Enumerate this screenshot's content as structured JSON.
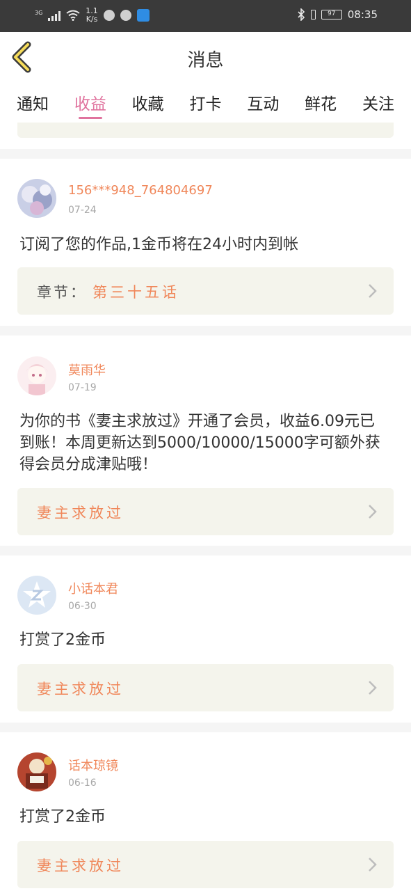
{
  "status_bar": {
    "network": "3G",
    "speed": "1.1",
    "speed_unit": "K/s",
    "battery": "97",
    "time": "08:35"
  },
  "header": {
    "title": "消息"
  },
  "tabs": [
    {
      "label": "通知",
      "active": false
    },
    {
      "label": "收益",
      "active": true
    },
    {
      "label": "收藏",
      "active": false
    },
    {
      "label": "打卡",
      "active": false
    },
    {
      "label": "互动",
      "active": false
    },
    {
      "label": "鲜花",
      "active": false
    },
    {
      "label": "关注",
      "active": false
    }
  ],
  "messages": [
    {
      "username": "156***948_764804697",
      "date": "07-24",
      "text": "订阅了您的作品,1金币将在24小时内到帐",
      "link_label": "章节：",
      "link_value": "第三十五话"
    },
    {
      "username": "莫雨华",
      "date": "07-19",
      "text": "为你的书《妻主求放过》开通了会员，收益6.09元已到账！本周更新达到5000/10000/15000字可额外获得会员分成津贴哦！",
      "link_label": "",
      "link_value": "妻主求放过"
    },
    {
      "username": "小话本君",
      "date": "06-30",
      "text": "打赏了2金币",
      "link_label": "",
      "link_value": "妻主求放过"
    },
    {
      "username": "话本琼镜",
      "date": "06-16",
      "text": "打赏了2金币",
      "link_label": "",
      "link_value": "妻主求放过"
    }
  ],
  "colors": {
    "accent_pink": "#e0739e",
    "accent_orange": "#f0875a",
    "status_bar_bg": "#3a3a3a",
    "link_box_bg": "#f4f4ec"
  }
}
